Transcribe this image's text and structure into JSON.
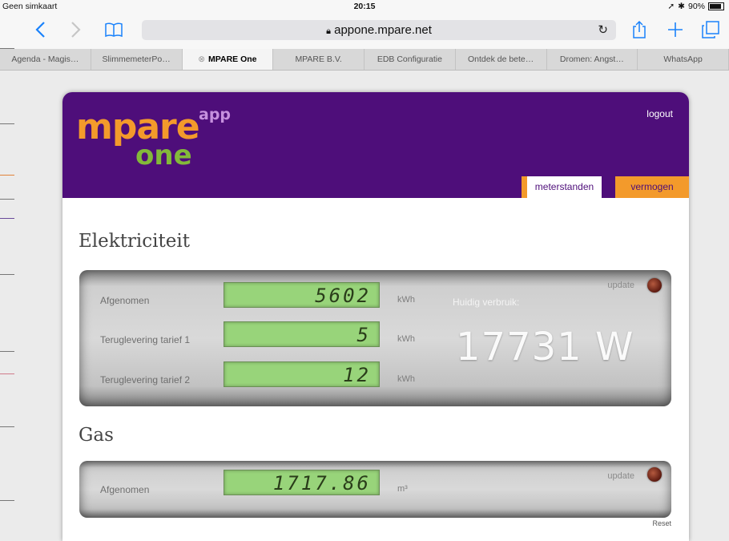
{
  "statusbar": {
    "carrier": "Geen simkaart",
    "time": "20:15",
    "battery": "90%"
  },
  "toolbar": {
    "url": "appone.mpare.net"
  },
  "tabs": [
    {
      "label": "Agenda - Magis…",
      "active": false
    },
    {
      "label": "SlimmemeterPo…",
      "active": false
    },
    {
      "label": "MPARE One",
      "active": true
    },
    {
      "label": "MPARE B.V.",
      "active": false
    },
    {
      "label": "EDB Configuratie",
      "active": false
    },
    {
      "label": "Ontdek de bete…",
      "active": false
    },
    {
      "label": "Dromen: Angst…",
      "active": false
    },
    {
      "label": "WhatsApp",
      "active": false
    }
  ],
  "header": {
    "logo_mpare": "mpare",
    "logo_app": "app",
    "logo_one": "one",
    "logout": "logout",
    "tab_meterstanden": "meterstanden",
    "tab_vermogen": "vermogen"
  },
  "elektriciteit": {
    "title": "Elektriciteit",
    "rows": [
      {
        "label": "Afgenomen",
        "value": "5602",
        "unit": "kWh"
      },
      {
        "label": "Teruglevering tarief 1",
        "value": "5",
        "unit": "kWh"
      },
      {
        "label": "Teruglevering tarief 2",
        "value": "12",
        "unit": "kWh"
      }
    ],
    "update": "update",
    "verbruik_label": "Huidig verbruik:",
    "verbruik_value": "17731 W"
  },
  "gas": {
    "title": "Gas",
    "label": "Afgenomen",
    "value": "1717.86",
    "unit": "m³",
    "update": "update"
  },
  "reset": "Reset",
  "colors": {
    "header_purple": "#4e0e7a",
    "brand_orange": "#f39a2b",
    "brand_green": "#83b93a",
    "lcd_green": "#98d47a",
    "ios_blue": "#1a82fb"
  }
}
